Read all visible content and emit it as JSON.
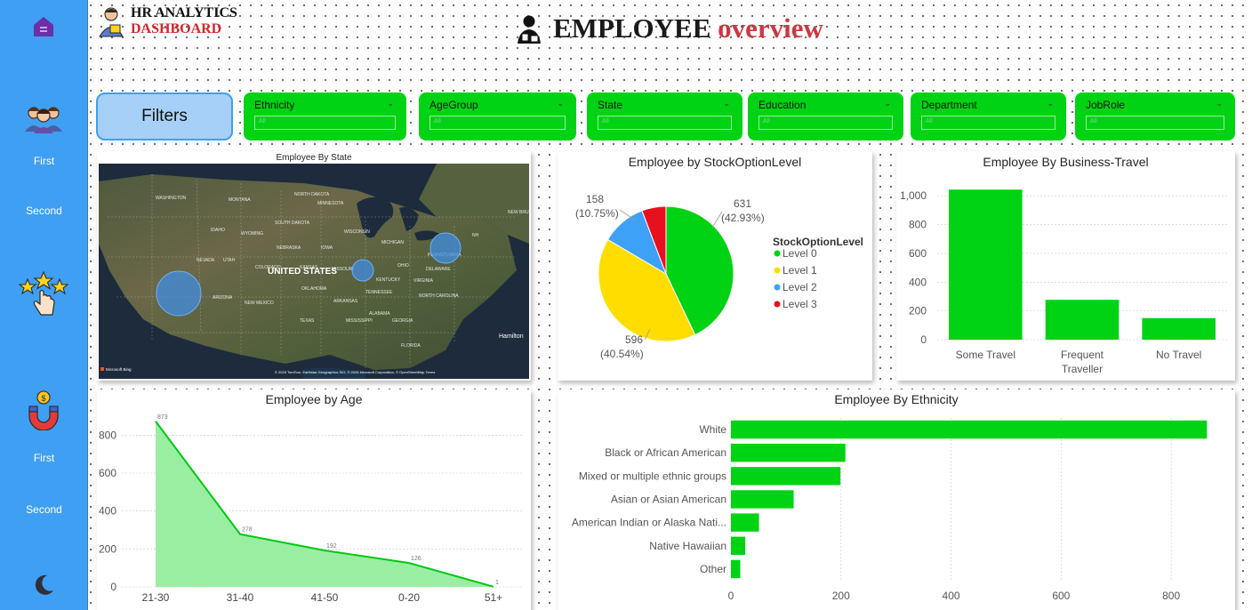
{
  "brand": {
    "line1": "HR ANALYTICS",
    "line2": "DASHBOARD"
  },
  "title": {
    "part1": "EMPLOYEE",
    "part2": "overview"
  },
  "sidebar": {
    "first_label_1": "First",
    "second_label_1": "Second",
    "first_label_2": "First",
    "second_label_2": "Second"
  },
  "filters": {
    "button_label": "Filters",
    "slicers": [
      {
        "title": "Ethnicity",
        "value": "All"
      },
      {
        "title": "AgeGroup",
        "value": "All"
      },
      {
        "title": "State",
        "value": "All"
      },
      {
        "title": "Education",
        "value": "All"
      },
      {
        "title": "Department",
        "value": "All"
      },
      {
        "title": "JobRole",
        "value": "All"
      }
    ]
  },
  "colors": {
    "sidebar": "#3f9ff2",
    "accent_green": "#00d314",
    "title_red": "#c83a42"
  },
  "map": {
    "title": "Employee By State",
    "country_label": "UNITED STATES",
    "city_label": "Hamilton",
    "attribution": "© 2025 TomTom, Earthstar Geographics SIO, © 2025 Microsoft Corporation, © OpenStreetMap   Terms",
    "bing_label": "Microsoft Bing",
    "bubbles": [
      {
        "state": "CALIFORNIA",
        "relative_size": 1.0
      },
      {
        "state": "ILLINOIS",
        "relative_size": 0.5
      },
      {
        "state": "NEW YORK",
        "relative_size": 0.7
      }
    ]
  },
  "chart_data": [
    {
      "type": "pie",
      "title": "Employee by StockOptionLevel",
      "legend_title": "StockOptionLevel",
      "legend_position": "right",
      "slices": [
        {
          "label": "Level 0",
          "value": 631,
          "pct": "42.93%",
          "color": "#00d314"
        },
        {
          "label": "Level 1",
          "value": 596,
          "pct": "40.54%",
          "color": "#ffdd00"
        },
        {
          "label": "Level 2",
          "value": 158,
          "pct": "10.75%",
          "color": "#3ea1f8"
        },
        {
          "label": "Level 3",
          "value": 85,
          "pct": "",
          "color": "#e8101e"
        }
      ],
      "data_labels": [
        {
          "value": "631",
          "pct": "(42.93%)"
        },
        {
          "value": "596",
          "pct": "(40.54%)"
        },
        {
          "value": "158",
          "pct": "(10.75%)"
        }
      ]
    },
    {
      "type": "bar",
      "title": "Employee By Business-Travel",
      "categories": [
        "Some Travel",
        "Frequent\nTraveller",
        "No Travel"
      ],
      "values": [
        1043,
        277,
        150
      ],
      "ylim": [
        0,
        1100
      ],
      "yticks": [
        "0",
        "200",
        "400",
        "600",
        "800",
        "1,000"
      ],
      "ytick_values": [
        0,
        200,
        400,
        600,
        800,
        1000
      ],
      "color": "#00d314"
    },
    {
      "type": "area",
      "title": "Employee by Age",
      "categories": [
        "21-30",
        "31-40",
        "41-50",
        "0-20",
        "51+"
      ],
      "values": [
        873,
        278,
        192,
        126,
        1
      ],
      "data_labels": [
        "873",
        "278",
        "192",
        "126",
        "1"
      ],
      "ylim": [
        0,
        900
      ],
      "yticks": [
        "0",
        "200",
        "400",
        "600",
        "800"
      ],
      "ytick_values": [
        0,
        200,
        400,
        600,
        800
      ],
      "color": "#00c814",
      "fill": "#9aeea1"
    },
    {
      "type": "bar",
      "orientation": "horizontal",
      "title": "Employee By Ethnicity",
      "categories": [
        "White",
        "Black or African American",
        "Mixed or multiple ethnic groups",
        "Asian or Asian American",
        "American Indian or Alaska Nati...",
        "Native Hawaiian",
        "Other"
      ],
      "values": [
        865,
        208,
        199,
        114,
        51,
        26,
        17
      ],
      "xlim": [
        0,
        900
      ],
      "xticks": [
        "0",
        "200",
        "400",
        "600",
        "800"
      ],
      "xtick_values": [
        0,
        200,
        400,
        600,
        800
      ],
      "color": "#00d314"
    }
  ]
}
